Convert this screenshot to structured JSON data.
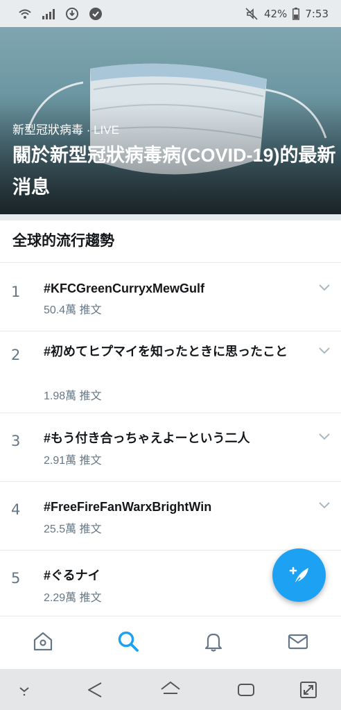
{
  "status_bar": {
    "battery_percent": "42%",
    "time": "7:53",
    "icons": [
      "wifi-icon",
      "signal-icon",
      "download-icon",
      "check-icon",
      "mute-icon",
      "battery-icon"
    ]
  },
  "hero": {
    "subtitle": "新型冠狀病毒 · LIVE",
    "title": "關於新型冠狀病毒病(COVID-19)的最新消息"
  },
  "trends": {
    "heading": "全球的流行趨勢",
    "items": [
      {
        "rank": "1",
        "tag": "#KFCGreenCurryxMewGulf",
        "count": "50.4萬 推文"
      },
      {
        "rank": "2",
        "tag": "#初めてヒプマイを知ったときに思ったこと",
        "count": "1.98萬 推文"
      },
      {
        "rank": "3",
        "tag": "#もう付き合っちゃえよーという二人",
        "count": "2.91萬 推文"
      },
      {
        "rank": "4",
        "tag": "#FreeFireFanWarxBrightWin",
        "count": "25.5萬 推文"
      },
      {
        "rank": "5",
        "tag": "#ぐるナイ",
        "count": "2.29萬 推文"
      }
    ]
  },
  "fab": {
    "icon": "compose-feather-icon"
  },
  "tab_bar": {
    "tabs": [
      "home-icon",
      "search-icon",
      "bell-icon",
      "mail-icon"
    ],
    "active": "search-icon",
    "accent": "#1da1f2"
  },
  "nav_bar": {
    "buttons": [
      "hide-keyboard-icon",
      "back-icon",
      "home-icon",
      "recents-icon",
      "rotate-icon"
    ]
  }
}
